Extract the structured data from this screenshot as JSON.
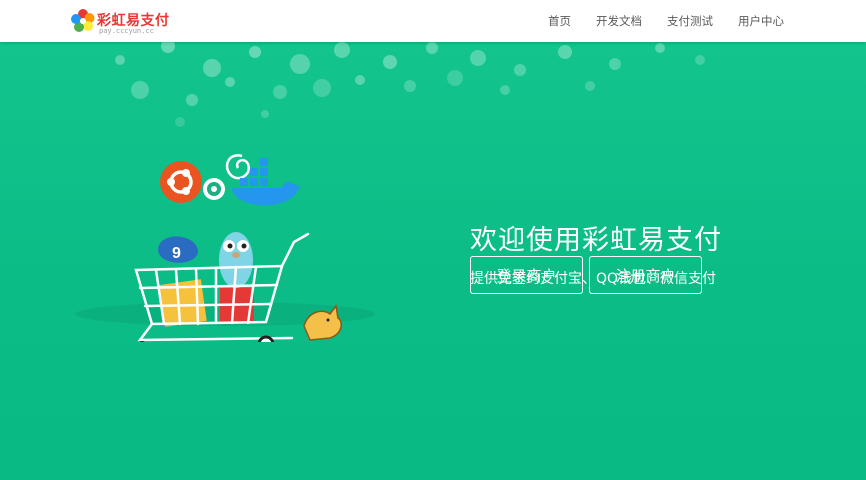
{
  "header": {
    "logo": {
      "name": "彩虹易支付",
      "sub": "pay.cccyun.cc"
    },
    "nav": [
      {
        "label": "首页"
      },
      {
        "label": "开发文档"
      },
      {
        "label": "支付测试"
      },
      {
        "label": "用户中心"
      }
    ]
  },
  "hero": {
    "title": "欢迎使用彩虹易支付",
    "subtitle": "提供免签约支付宝、QQ钱包、微信支付",
    "buttons": {
      "login": "登录商户",
      "register": "注册商户"
    },
    "illustration": {
      "description_icons": [
        "ubuntu-icon",
        "kubernetes-icon",
        "docker-icon",
        "go-gopher-icon",
        "debian-swirl-icon",
        "cart-icon",
        "tomcat-icon"
      ],
      "badge_number": "9"
    }
  },
  "colors": {
    "hero_bg": "#0fbf88",
    "brand_red": "#e53935",
    "header_bg": "#ffffff"
  }
}
